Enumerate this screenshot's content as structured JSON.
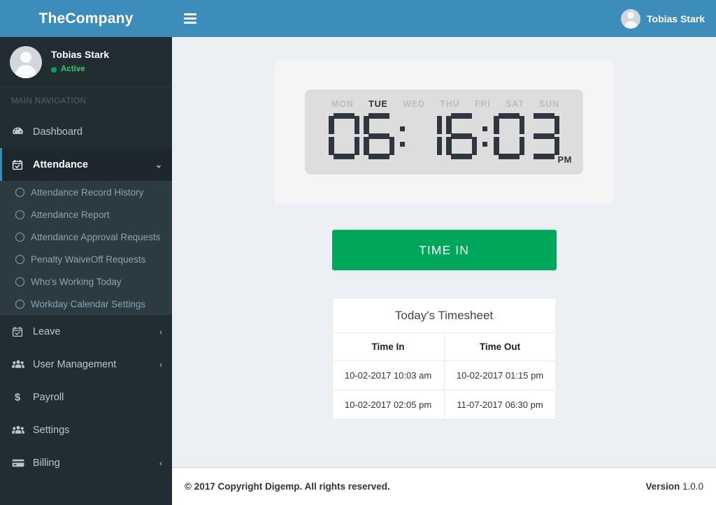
{
  "brand": {
    "name": "TheCompany"
  },
  "topbar": {
    "menu_icon": "hamburger-icon",
    "user_name": "Tobias Stark",
    "avatar_icon": "avatar-icon"
  },
  "sidebar": {
    "user": {
      "name": "Tobias Stark",
      "status": "Active",
      "status_color": "#00a65a"
    },
    "nav_header": "MAIN NAVIGATION",
    "items": [
      {
        "label": "Dashboard",
        "icon": "dashboard-icon",
        "arrow": "",
        "active": false
      },
      {
        "label": "Attendance",
        "icon": "calendar-check-icon",
        "arrow": "⌄",
        "active": true
      },
      {
        "label": "Leave",
        "icon": "calendar-check-icon",
        "arrow": "‹",
        "active": false
      },
      {
        "label": "User Management",
        "icon": "users-icon",
        "arrow": "‹",
        "active": false
      },
      {
        "label": "Payroll",
        "icon": "dollar-icon",
        "arrow": "",
        "active": false
      },
      {
        "label": "Settings",
        "icon": "users-icon",
        "arrow": "",
        "active": false
      },
      {
        "label": "Billing",
        "icon": "credit-card-icon",
        "arrow": "‹",
        "active": false
      }
    ],
    "submenu": [
      {
        "label": "Attendance Record History"
      },
      {
        "label": "Attendance Report"
      },
      {
        "label": "Attendance Approval Requests"
      },
      {
        "label": "Penalty WaiveOff Requests"
      },
      {
        "label": "Who's Working Today"
      },
      {
        "label": "Workday Calendar Settings"
      }
    ]
  },
  "clock": {
    "days": [
      {
        "label": "MON",
        "active": false
      },
      {
        "label": "TUE",
        "active": true
      },
      {
        "label": "WED",
        "active": false
      },
      {
        "label": "THU",
        "active": false
      },
      {
        "label": "FRI",
        "active": false
      },
      {
        "label": "SAT",
        "active": false
      },
      {
        "label": "SUN",
        "active": false
      }
    ],
    "hours": "06",
    "minutes": "16",
    "seconds": "03",
    "meridiem": "PM",
    "time_display": "06:16:03",
    "segment_color": "#2f3640",
    "face_color": "#dddddd"
  },
  "actions": {
    "time_in_label": "TIME IN",
    "time_in_color": "#00a65a"
  },
  "timesheet": {
    "title": "Today's Timesheet",
    "columns": [
      "Time In",
      "Time Out"
    ],
    "rows": [
      {
        "time_in": "10-02-2017 10:03 am",
        "time_out": "10-02-2017 01:15 pm"
      },
      {
        "time_in": "10-02-2017 02:05 pm",
        "time_out": "11-07-2017 06:30 pm"
      }
    ]
  },
  "footer": {
    "copyright": "© 2017 Copyright Digemp. All rights reserved.",
    "version_label": "Version",
    "version_value": "1.0.0"
  },
  "theme": {
    "brand_blue": "#3c8dbc",
    "sidebar_dark": "#222d32",
    "sidebar_active": "#1e282c",
    "submenu_bg": "#2c3b41",
    "content_bg": "#ecf0f5",
    "green": "#00a65a"
  }
}
